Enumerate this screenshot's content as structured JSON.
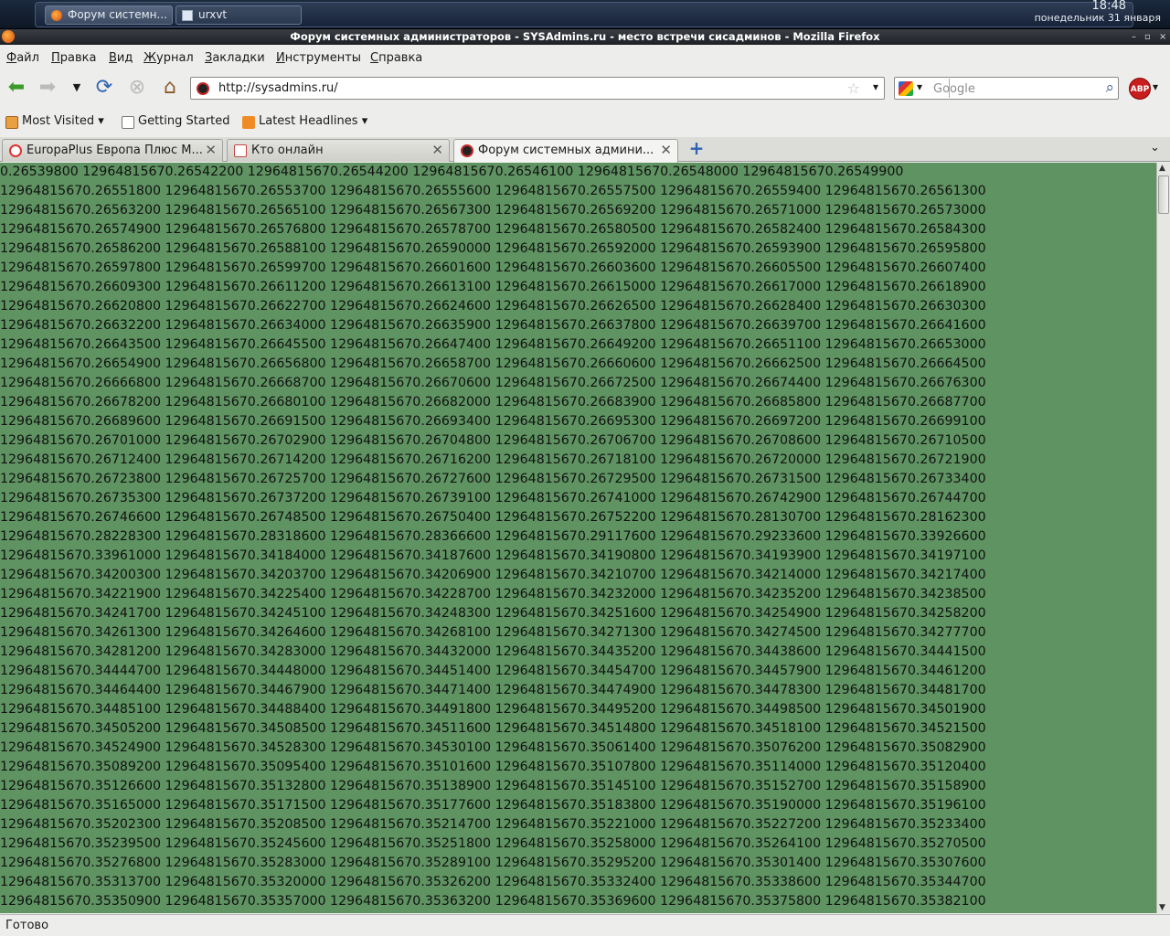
{
  "taskbar": {
    "tasks": [
      {
        "label": "Форум системн...",
        "icon": "firefox-icon"
      },
      {
        "label": "urxvt",
        "icon": "terminal-icon"
      }
    ],
    "time": "18:48",
    "date": "понедельник 31 января"
  },
  "window": {
    "title": "Форум системных администраторов - SYSAdmins.ru - место встречи сисадминов - Mozilla Firefox",
    "controls": [
      "–",
      "▫",
      "×"
    ]
  },
  "menu": [
    {
      "accel": "Ф",
      "rest": "айл"
    },
    {
      "accel": "П",
      "rest": "равка"
    },
    {
      "accel": "В",
      "rest": "ид"
    },
    {
      "accel": "Ж",
      "rest": "урнал"
    },
    {
      "accel": "З",
      "rest": "акладки"
    },
    {
      "accel": "И",
      "rest": "нструменты"
    },
    {
      "accel": "С",
      "rest": "правка"
    }
  ],
  "navigation": {
    "url": "http://sysadmins.ru/",
    "search_placeholder": "Google",
    "abp_label": "ABP"
  },
  "bookmarks": [
    {
      "label": "Most Visited",
      "icon": "most-visited-icon",
      "dropdown": "▾"
    },
    {
      "label": "Getting Started",
      "icon": "page-icon",
      "dropdown": ""
    },
    {
      "label": "Latest Headlines",
      "icon": "rss-icon",
      "dropdown": "▾"
    }
  ],
  "tabs": [
    {
      "label": "EuropaPlus Европа Плюс М...",
      "close": "✕"
    },
    {
      "label": "Кто онлайн",
      "close": "✕"
    },
    {
      "label": "Форум системных админи...",
      "close": "✕"
    }
  ],
  "content": {
    "text": "0.26539800 12964815670.26542200 12964815670.26544200 12964815670.26546100 12964815670.26548000 12964815670.26549900\n12964815670.26551800 12964815670.26553700 12964815670.26555600 12964815670.26557500 12964815670.26559400 12964815670.26561300\n12964815670.26563200 12964815670.26565100 12964815670.26567300 12964815670.26569200 12964815670.26571000 12964815670.26573000\n12964815670.26574900 12964815670.26576800 12964815670.26578700 12964815670.26580500 12964815670.26582400 12964815670.26584300\n12964815670.26586200 12964815670.26588100 12964815670.26590000 12964815670.26592000 12964815670.26593900 12964815670.26595800\n12964815670.26597800 12964815670.26599700 12964815670.26601600 12964815670.26603600 12964815670.26605500 12964815670.26607400\n12964815670.26609300 12964815670.26611200 12964815670.26613100 12964815670.26615000 12964815670.26617000 12964815670.26618900\n12964815670.26620800 12964815670.26622700 12964815670.26624600 12964815670.26626500 12964815670.26628400 12964815670.26630300\n12964815670.26632200 12964815670.26634000 12964815670.26635900 12964815670.26637800 12964815670.26639700 12964815670.26641600\n12964815670.26643500 12964815670.26645500 12964815670.26647400 12964815670.26649200 12964815670.26651100 12964815670.26653000\n12964815670.26654900 12964815670.26656800 12964815670.26658700 12964815670.26660600 12964815670.26662500 12964815670.26664500\n12964815670.26666800 12964815670.26668700 12964815670.26670600 12964815670.26672500 12964815670.26674400 12964815670.26676300\n12964815670.26678200 12964815670.26680100 12964815670.26682000 12964815670.26683900 12964815670.26685800 12964815670.26687700\n12964815670.26689600 12964815670.26691500 12964815670.26693400 12964815670.26695300 12964815670.26697200 12964815670.26699100\n12964815670.26701000 12964815670.26702900 12964815670.26704800 12964815670.26706700 12964815670.26708600 12964815670.26710500\n12964815670.26712400 12964815670.26714200 12964815670.26716200 12964815670.26718100 12964815670.26720000 12964815670.26721900\n12964815670.26723800 12964815670.26725700 12964815670.26727600 12964815670.26729500 12964815670.26731500 12964815670.26733400\n12964815670.26735300 12964815670.26737200 12964815670.26739100 12964815670.26741000 12964815670.26742900 12964815670.26744700\n12964815670.26746600 12964815670.26748500 12964815670.26750400 12964815670.26752200 12964815670.28130700 12964815670.28162300\n12964815670.28228300 12964815670.28318600 12964815670.28366600 12964815670.29117600 12964815670.29233600 12964815670.33926600\n12964815670.33961000 12964815670.34184000 12964815670.34187600 12964815670.34190800 12964815670.34193900 12964815670.34197100\n12964815670.34200300 12964815670.34203700 12964815670.34206900 12964815670.34210700 12964815670.34214000 12964815670.34217400\n12964815670.34221900 12964815670.34225400 12964815670.34228700 12964815670.34232000 12964815670.34235200 12964815670.34238500\n12964815670.34241700 12964815670.34245100 12964815670.34248300 12964815670.34251600 12964815670.34254900 12964815670.34258200\n12964815670.34261300 12964815670.34264600 12964815670.34268100 12964815670.34271300 12964815670.34274500 12964815670.34277700\n12964815670.34281200 12964815670.34283000 12964815670.34432000 12964815670.34435200 12964815670.34438600 12964815670.34441500\n12964815670.34444700 12964815670.34448000 12964815670.34451400 12964815670.34454700 12964815670.34457900 12964815670.34461200\n12964815670.34464400 12964815670.34467900 12964815670.34471400 12964815670.34474900 12964815670.34478300 12964815670.34481700\n12964815670.34485100 12964815670.34488400 12964815670.34491800 12964815670.34495200 12964815670.34498500 12964815670.34501900\n12964815670.34505200 12964815670.34508500 12964815670.34511600 12964815670.34514800 12964815670.34518100 12964815670.34521500\n12964815670.34524900 12964815670.34528300 12964815670.34530100 12964815670.35061400 12964815670.35076200 12964815670.35082900\n12964815670.35089200 12964815670.35095400 12964815670.35101600 12964815670.35107800 12964815670.35114000 12964815670.35120400\n12964815670.35126600 12964815670.35132800 12964815670.35138900 12964815670.35145100 12964815670.35152700 12964815670.35158900\n12964815670.35165000 12964815670.35171500 12964815670.35177600 12964815670.35183800 12964815670.35190000 12964815670.35196100\n12964815670.35202300 12964815670.35208500 12964815670.35214700 12964815670.35221000 12964815670.35227200 12964815670.35233400\n12964815670.35239500 12964815670.35245600 12964815670.35251800 12964815670.35258000 12964815670.35264100 12964815670.35270500\n12964815670.35276800 12964815670.35283000 12964815670.35289100 12964815670.35295200 12964815670.35301400 12964815670.35307600\n12964815670.35313700 12964815670.35320000 12964815670.35326200 12964815670.35332400 12964815670.35338600 12964815670.35344700\n12964815670.35350900 12964815670.35357000 12964815670.35363200 12964815670.35369600 12964815670.35375800 12964815670.35382100"
  },
  "status": "Готово",
  "colors": {
    "content_bg": "#5f9362",
    "abp_red": "#c81e1e"
  }
}
